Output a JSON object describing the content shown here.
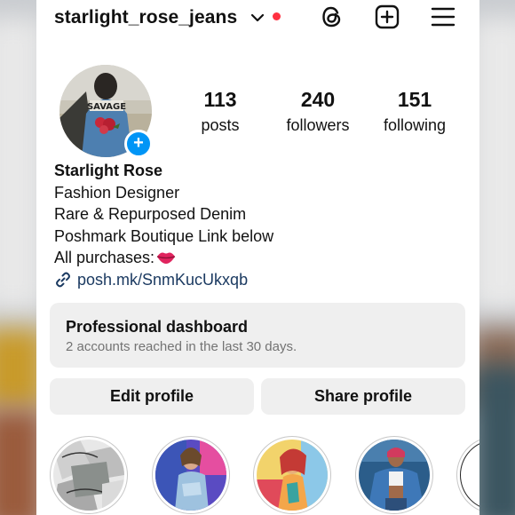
{
  "header": {
    "username": "starlight_rose_jeans",
    "icons": [
      "chevron-down-icon",
      "notification-dot",
      "threads-icon",
      "new-post-icon",
      "menu-icon"
    ]
  },
  "avatar": {
    "jacket_text": "SAVAGE"
  },
  "stats": {
    "posts": {
      "value": "113",
      "label": "posts"
    },
    "followers": {
      "value": "240",
      "label": "followers"
    },
    "following": {
      "value": "151",
      "label": "following"
    }
  },
  "bio": {
    "name": "Starlight Rose",
    "line1": "Fashion Designer",
    "line2": "Rare & Repurposed Denim",
    "line3": "Poshmark Boutique Link below",
    "line4": "All purchases:",
    "link": "posh.mk/SnmKucUkxqb"
  },
  "dashboard": {
    "title": "Professional dashboard",
    "subtitle": "2 accounts reached in the last 30 days."
  },
  "buttons": {
    "edit": "Edit profile",
    "share": "Share profile"
  },
  "colors": {
    "accent": "#0095f6",
    "notification": "#ff3040",
    "link": "#1b3a61",
    "button_bg": "#efefef"
  }
}
